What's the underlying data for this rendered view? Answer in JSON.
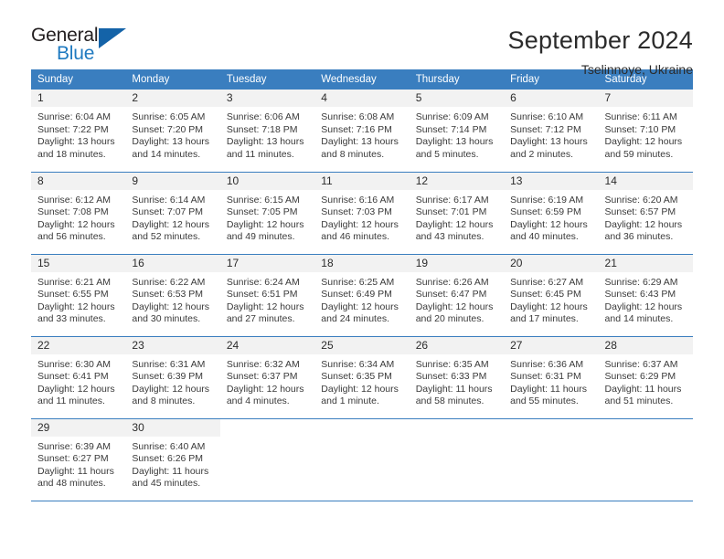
{
  "brand": {
    "name_top": "General",
    "name_bottom": "Blue",
    "triangle_icon": "triangle-icon",
    "accent_color": "#1463a8",
    "text_color": "#231f20"
  },
  "header": {
    "title": "September 2024",
    "subtitle": "Tselinnoye, Ukraine"
  },
  "colors": {
    "header_row_bg": "#3a7ebf",
    "daynum_bg": "#f2f2f2",
    "grid_line": "#3a7ebf",
    "body_text": "#3a3a3a"
  },
  "weekday_headers": [
    "Sunday",
    "Monday",
    "Tuesday",
    "Wednesday",
    "Thursday",
    "Friday",
    "Saturday"
  ],
  "weeks": [
    [
      {
        "day": "1",
        "sunrise": "Sunrise: 6:04 AM",
        "sunset": "Sunset: 7:22 PM",
        "daylight_1": "Daylight: 13 hours",
        "daylight_2": "and 18 minutes."
      },
      {
        "day": "2",
        "sunrise": "Sunrise: 6:05 AM",
        "sunset": "Sunset: 7:20 PM",
        "daylight_1": "Daylight: 13 hours",
        "daylight_2": "and 14 minutes."
      },
      {
        "day": "3",
        "sunrise": "Sunrise: 6:06 AM",
        "sunset": "Sunset: 7:18 PM",
        "daylight_1": "Daylight: 13 hours",
        "daylight_2": "and 11 minutes."
      },
      {
        "day": "4",
        "sunrise": "Sunrise: 6:08 AM",
        "sunset": "Sunset: 7:16 PM",
        "daylight_1": "Daylight: 13 hours",
        "daylight_2": "and 8 minutes."
      },
      {
        "day": "5",
        "sunrise": "Sunrise: 6:09 AM",
        "sunset": "Sunset: 7:14 PM",
        "daylight_1": "Daylight: 13 hours",
        "daylight_2": "and 5 minutes."
      },
      {
        "day": "6",
        "sunrise": "Sunrise: 6:10 AM",
        "sunset": "Sunset: 7:12 PM",
        "daylight_1": "Daylight: 13 hours",
        "daylight_2": "and 2 minutes."
      },
      {
        "day": "7",
        "sunrise": "Sunrise: 6:11 AM",
        "sunset": "Sunset: 7:10 PM",
        "daylight_1": "Daylight: 12 hours",
        "daylight_2": "and 59 minutes."
      }
    ],
    [
      {
        "day": "8",
        "sunrise": "Sunrise: 6:12 AM",
        "sunset": "Sunset: 7:08 PM",
        "daylight_1": "Daylight: 12 hours",
        "daylight_2": "and 56 minutes."
      },
      {
        "day": "9",
        "sunrise": "Sunrise: 6:14 AM",
        "sunset": "Sunset: 7:07 PM",
        "daylight_1": "Daylight: 12 hours",
        "daylight_2": "and 52 minutes."
      },
      {
        "day": "10",
        "sunrise": "Sunrise: 6:15 AM",
        "sunset": "Sunset: 7:05 PM",
        "daylight_1": "Daylight: 12 hours",
        "daylight_2": "and 49 minutes."
      },
      {
        "day": "11",
        "sunrise": "Sunrise: 6:16 AM",
        "sunset": "Sunset: 7:03 PM",
        "daylight_1": "Daylight: 12 hours",
        "daylight_2": "and 46 minutes."
      },
      {
        "day": "12",
        "sunrise": "Sunrise: 6:17 AM",
        "sunset": "Sunset: 7:01 PM",
        "daylight_1": "Daylight: 12 hours",
        "daylight_2": "and 43 minutes."
      },
      {
        "day": "13",
        "sunrise": "Sunrise: 6:19 AM",
        "sunset": "Sunset: 6:59 PM",
        "daylight_1": "Daylight: 12 hours",
        "daylight_2": "and 40 minutes."
      },
      {
        "day": "14",
        "sunrise": "Sunrise: 6:20 AM",
        "sunset": "Sunset: 6:57 PM",
        "daylight_1": "Daylight: 12 hours",
        "daylight_2": "and 36 minutes."
      }
    ],
    [
      {
        "day": "15",
        "sunrise": "Sunrise: 6:21 AM",
        "sunset": "Sunset: 6:55 PM",
        "daylight_1": "Daylight: 12 hours",
        "daylight_2": "and 33 minutes."
      },
      {
        "day": "16",
        "sunrise": "Sunrise: 6:22 AM",
        "sunset": "Sunset: 6:53 PM",
        "daylight_1": "Daylight: 12 hours",
        "daylight_2": "and 30 minutes."
      },
      {
        "day": "17",
        "sunrise": "Sunrise: 6:24 AM",
        "sunset": "Sunset: 6:51 PM",
        "daylight_1": "Daylight: 12 hours",
        "daylight_2": "and 27 minutes."
      },
      {
        "day": "18",
        "sunrise": "Sunrise: 6:25 AM",
        "sunset": "Sunset: 6:49 PM",
        "daylight_1": "Daylight: 12 hours",
        "daylight_2": "and 24 minutes."
      },
      {
        "day": "19",
        "sunrise": "Sunrise: 6:26 AM",
        "sunset": "Sunset: 6:47 PM",
        "daylight_1": "Daylight: 12 hours",
        "daylight_2": "and 20 minutes."
      },
      {
        "day": "20",
        "sunrise": "Sunrise: 6:27 AM",
        "sunset": "Sunset: 6:45 PM",
        "daylight_1": "Daylight: 12 hours",
        "daylight_2": "and 17 minutes."
      },
      {
        "day": "21",
        "sunrise": "Sunrise: 6:29 AM",
        "sunset": "Sunset: 6:43 PM",
        "daylight_1": "Daylight: 12 hours",
        "daylight_2": "and 14 minutes."
      }
    ],
    [
      {
        "day": "22",
        "sunrise": "Sunrise: 6:30 AM",
        "sunset": "Sunset: 6:41 PM",
        "daylight_1": "Daylight: 12 hours",
        "daylight_2": "and 11 minutes."
      },
      {
        "day": "23",
        "sunrise": "Sunrise: 6:31 AM",
        "sunset": "Sunset: 6:39 PM",
        "daylight_1": "Daylight: 12 hours",
        "daylight_2": "and 8 minutes."
      },
      {
        "day": "24",
        "sunrise": "Sunrise: 6:32 AM",
        "sunset": "Sunset: 6:37 PM",
        "daylight_1": "Daylight: 12 hours",
        "daylight_2": "and 4 minutes."
      },
      {
        "day": "25",
        "sunrise": "Sunrise: 6:34 AM",
        "sunset": "Sunset: 6:35 PM",
        "daylight_1": "Daylight: 12 hours",
        "daylight_2": "and 1 minute."
      },
      {
        "day": "26",
        "sunrise": "Sunrise: 6:35 AM",
        "sunset": "Sunset: 6:33 PM",
        "daylight_1": "Daylight: 11 hours",
        "daylight_2": "and 58 minutes."
      },
      {
        "day": "27",
        "sunrise": "Sunrise: 6:36 AM",
        "sunset": "Sunset: 6:31 PM",
        "daylight_1": "Daylight: 11 hours",
        "daylight_2": "and 55 minutes."
      },
      {
        "day": "28",
        "sunrise": "Sunrise: 6:37 AM",
        "sunset": "Sunset: 6:29 PM",
        "daylight_1": "Daylight: 11 hours",
        "daylight_2": "and 51 minutes."
      }
    ],
    [
      {
        "day": "29",
        "sunrise": "Sunrise: 6:39 AM",
        "sunset": "Sunset: 6:27 PM",
        "daylight_1": "Daylight: 11 hours",
        "daylight_2": "and 48 minutes."
      },
      {
        "day": "30",
        "sunrise": "Sunrise: 6:40 AM",
        "sunset": "Sunset: 6:26 PM",
        "daylight_1": "Daylight: 11 hours",
        "daylight_2": "and 45 minutes."
      },
      {
        "day": "",
        "sunrise": "",
        "sunset": "",
        "daylight_1": "",
        "daylight_2": ""
      },
      {
        "day": "",
        "sunrise": "",
        "sunset": "",
        "daylight_1": "",
        "daylight_2": ""
      },
      {
        "day": "",
        "sunrise": "",
        "sunset": "",
        "daylight_1": "",
        "daylight_2": ""
      },
      {
        "day": "",
        "sunrise": "",
        "sunset": "",
        "daylight_1": "",
        "daylight_2": ""
      },
      {
        "day": "",
        "sunrise": "",
        "sunset": "",
        "daylight_1": "",
        "daylight_2": ""
      }
    ]
  ]
}
